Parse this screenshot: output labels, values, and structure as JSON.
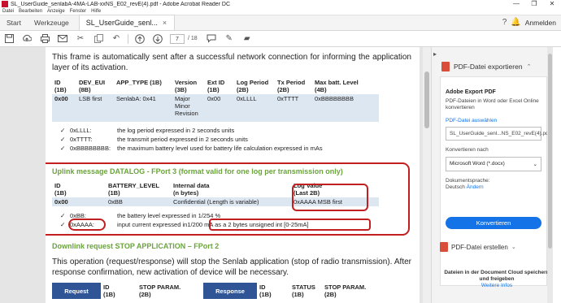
{
  "window": {
    "title": "SL_UserGuide_senlabA-4MA-LAB-xxNS_E02_revE(4).pdf - Adobe Acrobat Reader DC",
    "controls": [
      "—",
      "❐",
      "✕"
    ]
  },
  "menu": [
    "Datei",
    "Bearbeiten",
    "Anzeige",
    "Fenster",
    "Hilfe"
  ],
  "tabs": {
    "start": "Start",
    "werkzeuge": "Werkzeuge",
    "doc": "SL_UserGuide_senl...",
    "login": "Anmelden"
  },
  "toolbar": {
    "page_current": "7",
    "page_total": "/ 18"
  },
  "document": {
    "intro": "This frame is automatically sent after a successful network connection for informing the application layer of its activation.",
    "table1": {
      "headers": [
        [
          "ID",
          "(1B)"
        ],
        [
          "DEV_EUI",
          "(8B)"
        ],
        [
          "APP_TYPE (1B)",
          ""
        ],
        [
          "Version",
          "(3B)"
        ],
        [
          "Ext ID",
          "(1B)"
        ],
        [
          "Log Period",
          "(2B)"
        ],
        [
          "Tx Period",
          "(2B)"
        ],
        [
          "Max batt. Level",
          "(4B)"
        ]
      ],
      "row": [
        "0x00",
        "LSB first",
        "SenlabA: 0x41",
        "Major Minor Revision",
        "0x00",
        "0xLLLL",
        "0xTTTT",
        "0xBBBBBBBB"
      ]
    },
    "notes1": [
      {
        "k": "0xLLLL:",
        "v": "the log period expressed in 2 seconds units"
      },
      {
        "k": "0xTTTT:",
        "v": "the transmit period expressed in 2 seconds units"
      },
      {
        "k": "0xBBBBBBBB:",
        "v": "the maximum battery level used for battery life calculation expressed in mAs"
      }
    ],
    "uplink_heading": "Uplink message DATALOG - FPort 3 (format valid for one log per transmission only)",
    "table2": {
      "headers": [
        [
          "ID",
          "(1B)"
        ],
        [
          "BATTERY_LEVEL",
          "(1B)"
        ],
        [
          "Internal data",
          "(n bytes)"
        ],
        [
          "Log Value",
          "(Last 2B)"
        ]
      ],
      "row": [
        "0x00",
        "0xBB",
        "Confidential (Length is variable)",
        "0xAAAA MSB first"
      ]
    },
    "notes2": [
      {
        "k": "0xBB:",
        "v": "the battery level expressed in 1/254 %"
      },
      {
        "k": "0xAAAA:",
        "v_prefix": "input current expressed in ",
        "v_highlight": "1/200 mA as a 2 bytes unsigned int [0-25mA]"
      }
    ],
    "downlink_heading": "Downlink request STOP APPLICATION – FPort 2",
    "downlink_text": "This operation (request/response) will stop the Senlab application (stop of radio transmission). After response confirmation, new activation of device will be necessary.",
    "table3": {
      "request_label": "Request",
      "request_cols": [
        [
          "ID",
          "(1B)"
        ],
        [
          "STOP PARAM.",
          "(2B)"
        ]
      ],
      "response_label": "Response",
      "response_cols": [
        [
          "ID",
          "(1B)"
        ],
        [
          "STATUS",
          "(1B)"
        ],
        [
          "STOP PARAM.",
          "(2B)"
        ]
      ]
    }
  },
  "right_panel": {
    "export_title": "PDF-Datei exportieren",
    "card_title": "Adobe Export PDF",
    "card_desc": "PDF-Dateien in Word oder Excel Online konvertieren",
    "select_label": "PDF-Datei auswählen",
    "selected_file": "SL_UserGuide_senl...NS_E02_revE(4).pdf",
    "convert_to_label": "Konvertieren nach",
    "convert_to_value": "Microsoft Word (*.docx)",
    "doc_lang_label": "Dokumentsprache:",
    "doc_lang_value": "Deutsch",
    "doc_lang_change": "Ändern",
    "convert_button": "Konvertieren",
    "create_title": "PDF-Datei erstellen",
    "cloud_msg": "Dateien in der Document Cloud speichern und freigeben",
    "more_info": "Weitere Infos"
  }
}
